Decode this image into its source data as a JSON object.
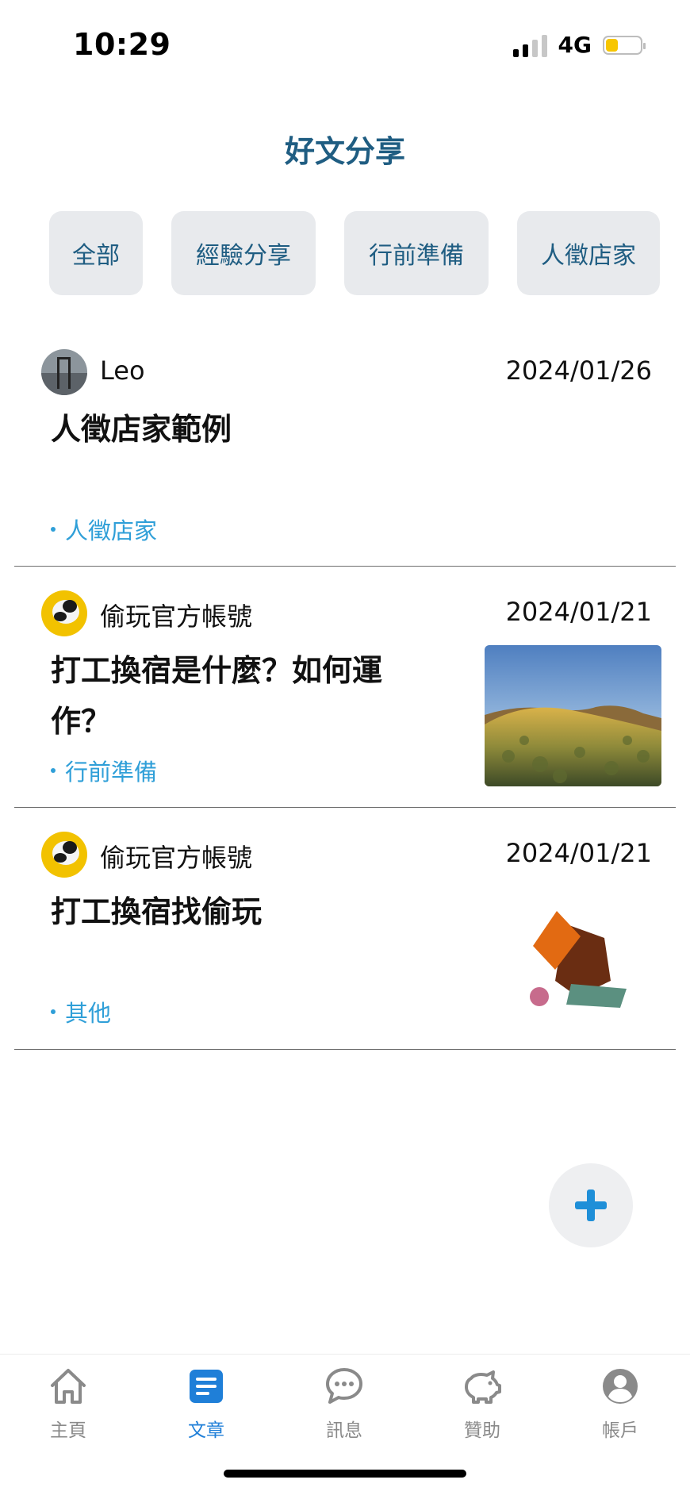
{
  "status_bar": {
    "time": "10:29",
    "network": "4G",
    "battery_level": 0.35,
    "signal_bars_active": 2
  },
  "header": {
    "title": "好文分享"
  },
  "categories": [
    {
      "label": "全部"
    },
    {
      "label": "經驗分享"
    },
    {
      "label": "行前準備"
    },
    {
      "label": "人徵店家"
    }
  ],
  "articles": [
    {
      "author": "Leo",
      "date": "2024/01/26",
      "title": "人徵店家範例",
      "tag": "人徵店家",
      "thumbnail": "none"
    },
    {
      "author": "偷玩官方帳號",
      "date": "2024/01/21",
      "title_line1": "打工換宿是什麼？如何運",
      "title_line2": "作？",
      "tag": "行前準備",
      "thumbnail": "mountain-landscape-photo"
    },
    {
      "author": "偷玩官方帳號",
      "date": "2024/01/21",
      "title": "打工換宿找偷玩",
      "tag": "其他",
      "thumbnail": "abstract-shapes-logo"
    }
  ],
  "fab": {
    "icon": "plus-icon",
    "color": "#1f8fd8"
  },
  "tabs": [
    {
      "label": "主頁",
      "icon": "home-icon"
    },
    {
      "label": "文章",
      "icon": "article-icon"
    },
    {
      "label": "訊息",
      "icon": "chat-icon"
    },
    {
      "label": "贊助",
      "icon": "piggy-bank-icon"
    },
    {
      "label": "帳戶",
      "icon": "account-icon"
    }
  ],
  "active_tab": "文章",
  "colors": {
    "title": "#1f5d82",
    "tag": "#2f9fd8",
    "active_tab": "#1f7fd8",
    "chip_bg": "#e8eaed"
  }
}
